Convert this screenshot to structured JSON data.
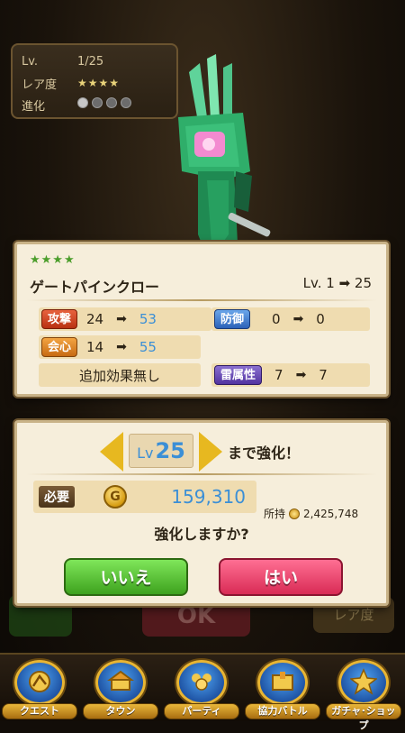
{
  "info": {
    "lv_label": "Lv.",
    "lv_value": "1/25",
    "rarity_label": "レア度",
    "rarity_stars": "★★★★",
    "evolve_label": "進化"
  },
  "card": {
    "stars": "★★★★",
    "name": "ゲートパインクロー",
    "level": "Lv. 1 ➡ 25",
    "stats": {
      "attack": {
        "label": "攻撃",
        "from": "24",
        "to": "53"
      },
      "defense": {
        "label": "防御",
        "from": "0",
        "to": "0"
      },
      "critical": {
        "label": "会心",
        "from": "14",
        "to": "55"
      },
      "effect": "追加効果無し",
      "element": {
        "label": "雷属性",
        "from": "7",
        "to": "7"
      }
    },
    "arrow": "➡"
  },
  "upgrade": {
    "lv_prefix": "Lv",
    "lv_target": "25",
    "until": "まで強化！",
    "required_label": "必要",
    "coin_glyph": "G",
    "cost": "159,310",
    "owned_label": "所持",
    "owned_value": "2,425,748",
    "question": "強化しますか?",
    "no_label": "いいえ",
    "yes_label": "はい"
  },
  "background": {
    "ok_label": "OK",
    "rarity_label": "レア度"
  },
  "nav": [
    {
      "label": "クエスト",
      "icon": "quest-icon"
    },
    {
      "label": "タウン",
      "icon": "town-icon"
    },
    {
      "label": "パーティ",
      "icon": "party-icon"
    },
    {
      "label": "協力バトル",
      "icon": "coop-battle-icon"
    },
    {
      "label": "ガチャ･ショップ",
      "icon": "gacha-shop-icon"
    }
  ],
  "colors": {
    "blue_value": "#3b8fd6",
    "no_button": "#3ea21e",
    "yes_button": "#d92b55",
    "gold": "#e7b820"
  }
}
